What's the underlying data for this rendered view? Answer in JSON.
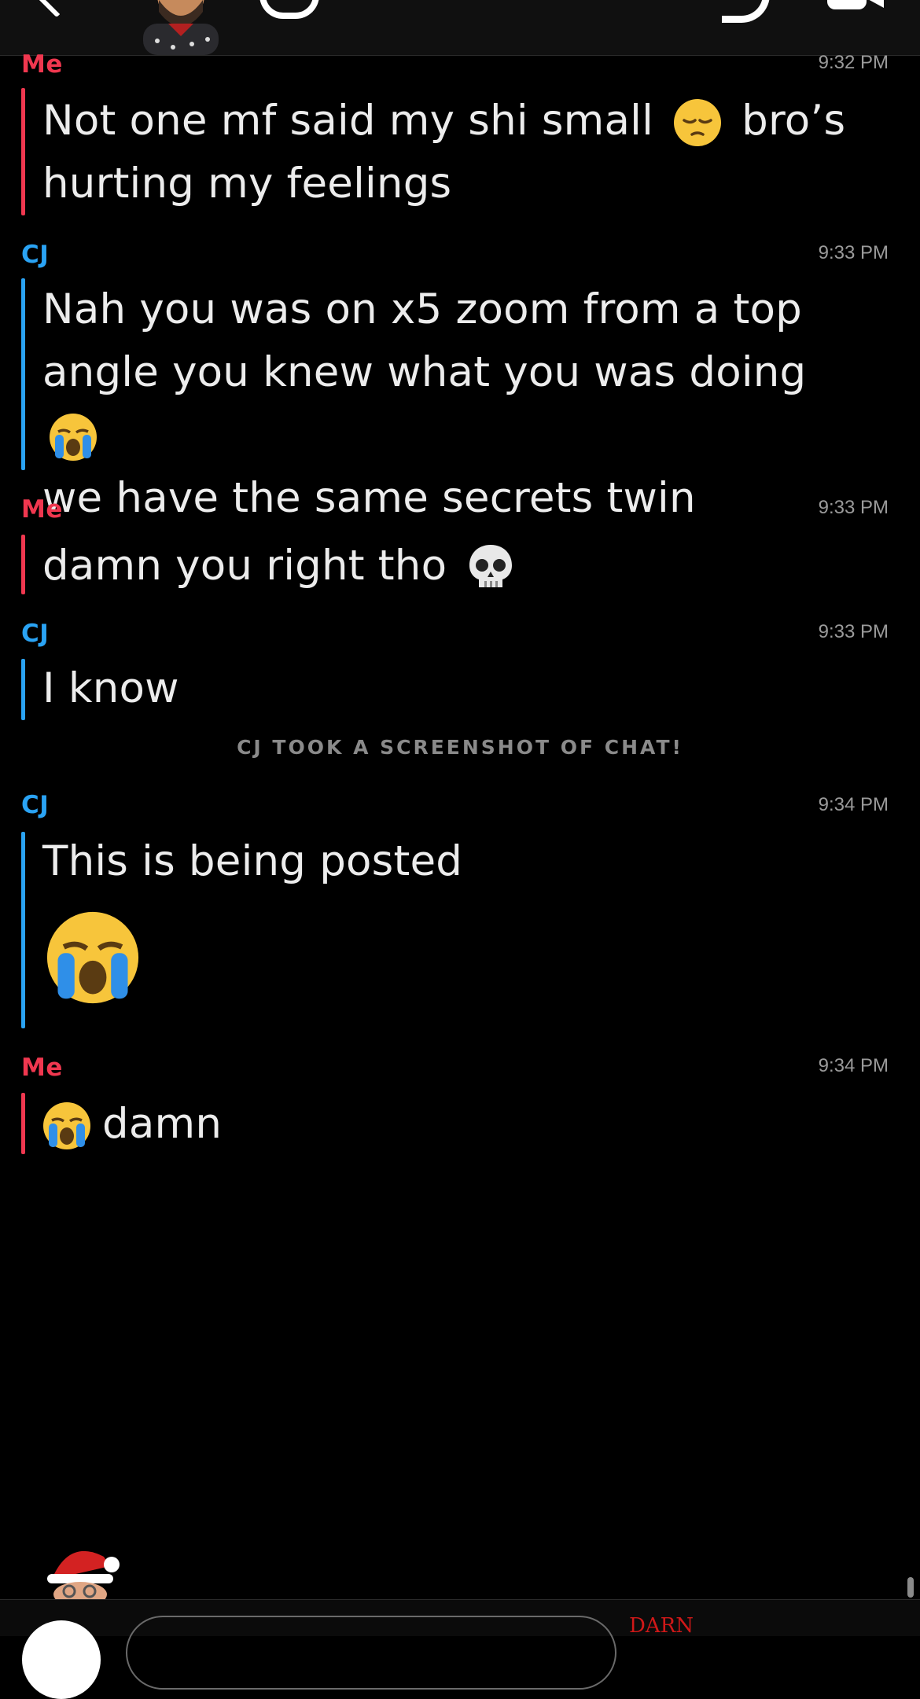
{
  "header": {
    "back_icon": "chevron-left-icon",
    "avatar_icon": "bitmoji-avatar-icon",
    "call_icon": "phone-icon",
    "video_icon": "video-camera-icon"
  },
  "colors": {
    "me": "#f0374f",
    "cj": "#2aa3f4",
    "background": "#000000"
  },
  "messages": [
    {
      "sender": "Me",
      "time": "9:32 PM",
      "lines": [
        "Not one mf said my shi small",
        "bro’s",
        "hurting my feelings"
      ],
      "emoji": "pensive-face-icon"
    },
    {
      "sender": "CJ",
      "time": "9:33 PM",
      "lines": [
        "Nah you was on x5 zoom from a top",
        "angle you knew what you was doing",
        "we have the same secrets twin"
      ],
      "emoji": "loudly-crying-face-icon"
    },
    {
      "sender": "Me",
      "time": "9:33 PM",
      "lines": [
        "damn you right tho"
      ],
      "emoji": "skull-icon"
    },
    {
      "sender": "CJ",
      "time": "9:33 PM",
      "lines": [
        "I know"
      ]
    },
    {
      "sender": "CJ",
      "time": "9:34 PM",
      "lines": [
        "This is being posted"
      ],
      "emoji": "loudly-crying-face-icon"
    },
    {
      "sender": "Me",
      "time": "9:34 PM",
      "lines": [
        "damn"
      ],
      "emoji": "loudly-crying-face-icon"
    }
  ],
  "system_notice": "CJ TOOK A SCREENSHOT OF CHAT!",
  "footer": {
    "bitmoji_icon": "santa-bitmoji-icon",
    "camera_icon": "camera-button-icon",
    "draft_text": "DARN"
  }
}
